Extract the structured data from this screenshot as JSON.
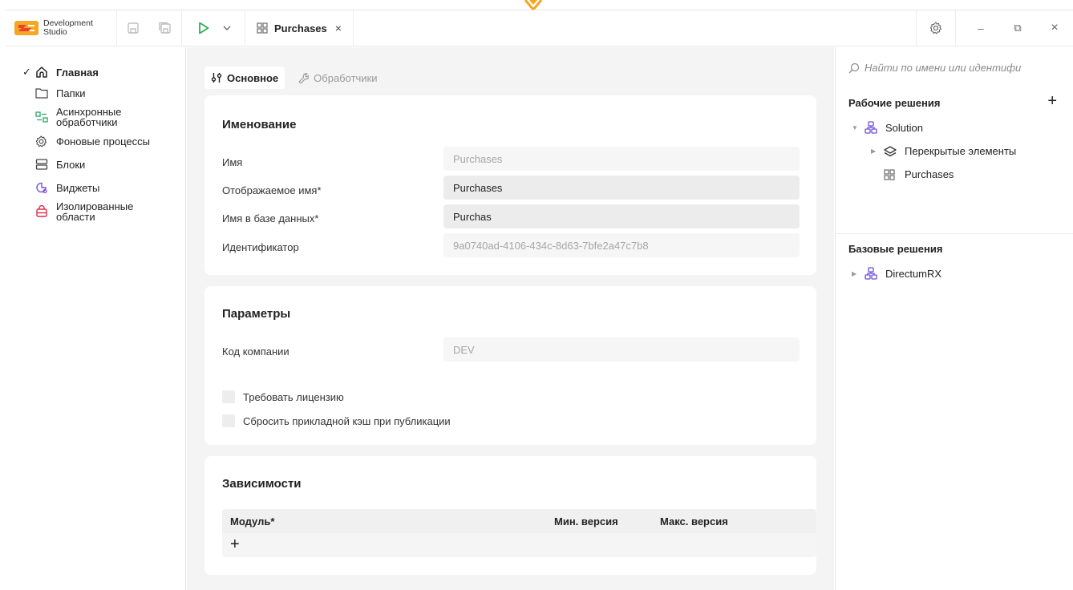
{
  "app": {
    "name_line1": "Development",
    "name_line2": "Studio"
  },
  "toolbar": {
    "tab_label": "Purchases",
    "tab_close": "×",
    "run_dropdown": "∨"
  },
  "window": {
    "minimize": "–",
    "restore": "⧉",
    "close": "×"
  },
  "sidebar": {
    "items": [
      {
        "label": "Главная",
        "checked": "✓"
      },
      {
        "label": "Папки"
      },
      {
        "label": "Асинхронные обработчики"
      },
      {
        "label": "Фоновые процессы"
      },
      {
        "label": "Блоки"
      },
      {
        "label": "Виджеты"
      },
      {
        "label": "Изолированные области"
      }
    ]
  },
  "subtabs": {
    "main": "Основное",
    "handlers": "Обработчики"
  },
  "naming": {
    "title": "Именование",
    "name_label": "Имя",
    "name_value": "Purchases",
    "display_label": "Отображаемое имя*",
    "display_value": "Purchases",
    "db_label": "Имя в базе данных*",
    "db_value": "Purchas",
    "id_label": "Идентификатор",
    "id_value": "9a0740ad-4106-434c-8d63-7bfe2a47c7b8"
  },
  "params": {
    "title": "Параметры",
    "company_label": "Код компании",
    "company_value": "DEV",
    "license_label": "Требовать лицензию",
    "cache_label": "Сбросить прикладной кэш при публикации"
  },
  "deps": {
    "title": "Зависимости",
    "col_module": "Модуль*",
    "col_min": "Мин. версия",
    "col_max": "Макс. версия",
    "add": "+"
  },
  "rpanel": {
    "search_placeholder": "Найти по имени или идентифи",
    "working_title": "Рабочие решения",
    "add": "+",
    "solution": "Solution",
    "overlapped": "Перекрытые элементы",
    "purchases": "Purchases",
    "base_title": "Базовые решения",
    "directum": "DirectumRX"
  },
  "colors": {
    "accent_orange": "#f5a623",
    "run_green": "#2bb24c",
    "async_green": "#2aa66b",
    "widget_purple": "#7a4fd6",
    "isolated_red": "#d9304f",
    "solution_purple": "#6b4fd6"
  }
}
